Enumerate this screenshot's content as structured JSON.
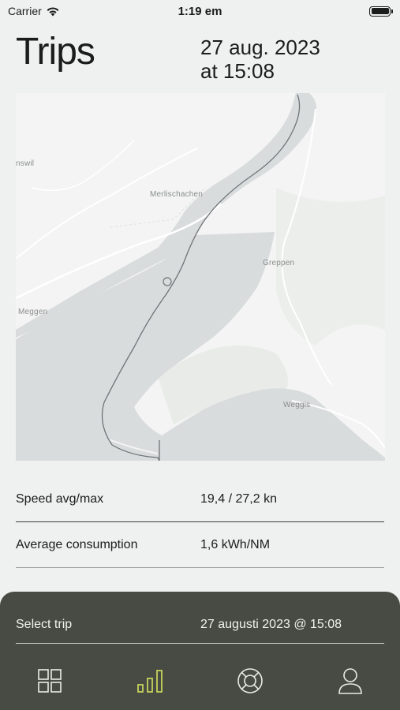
{
  "status_bar": {
    "carrier": "Carrier",
    "time": "1:19 em"
  },
  "header": {
    "title": "Trips",
    "date_line1": "27 aug. 2023",
    "date_line2": "at 15:08"
  },
  "map": {
    "labels": {
      "nswil": "nswil",
      "merlischachen": "Merlischachen",
      "greppen": "Greppen",
      "meggen": "Meggen",
      "weggis": "Weggis"
    },
    "colors": {
      "land": "#f3f4f3",
      "water": "#d9dcdd",
      "route": "#6f7476",
      "roads": "#ffffff"
    }
  },
  "stats": [
    {
      "label": "Speed avg/max",
      "value": "19,4 / 27,2 kn"
    },
    {
      "label": "Average consumption",
      "value": "1,6 kWh/NM"
    }
  ],
  "trip_selector": {
    "label": "Select trip",
    "value": "27 augusti 2023 @ 15:08"
  },
  "tabs": [
    {
      "icon": "grid-icon",
      "active": false
    },
    {
      "icon": "bar-chart-icon",
      "active": true
    },
    {
      "icon": "lifebuoy-icon",
      "active": false
    },
    {
      "icon": "user-icon",
      "active": false
    }
  ],
  "colors": {
    "background": "#eef1ef",
    "sheet": "#474b43",
    "accent": "#c6d35a",
    "text": "#1b1d1c"
  }
}
